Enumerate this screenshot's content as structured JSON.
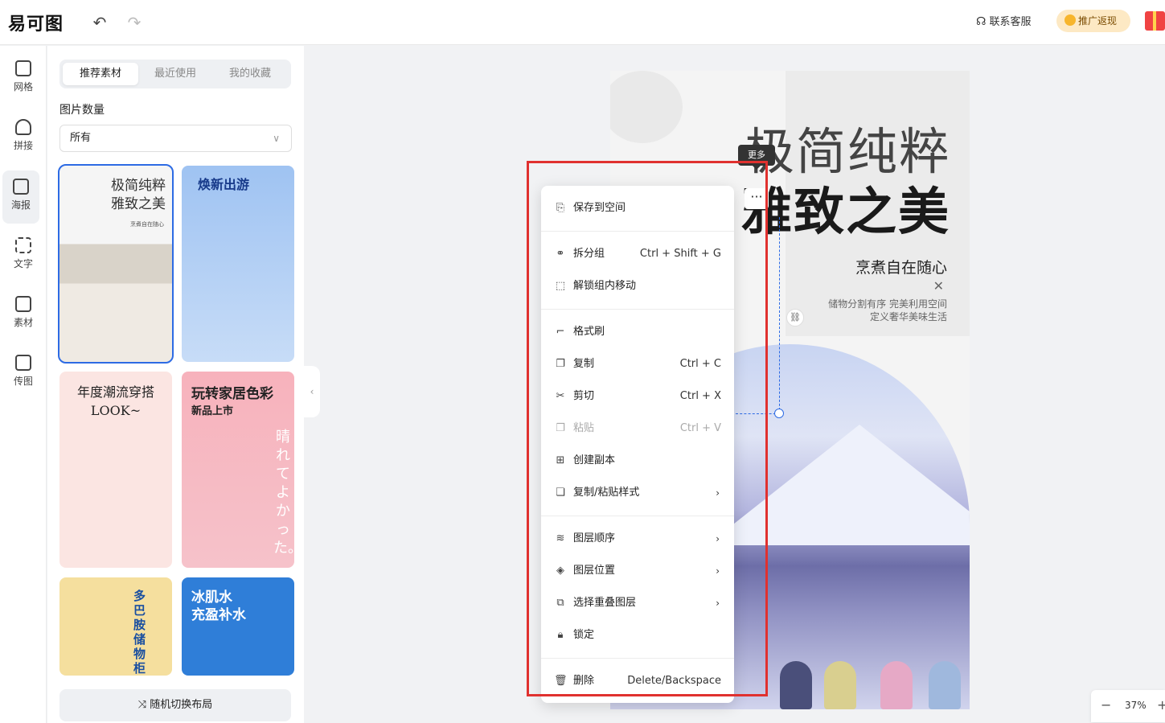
{
  "header": {
    "logo": "易可图",
    "undo_icon": "↶",
    "redo_icon": "↷",
    "support_label": "联系客服",
    "promo_label": "推广返现"
  },
  "rail": {
    "items": [
      {
        "label": "网格",
        "icon": "grid-icon"
      },
      {
        "label": "拼接",
        "icon": "splice-icon"
      },
      {
        "label": "海报",
        "icon": "poster-icon"
      },
      {
        "label": "文字",
        "icon": "text-icon"
      },
      {
        "label": "素材",
        "icon": "material-icon"
      },
      {
        "label": "传图",
        "icon": "upload-image-icon"
      }
    ],
    "active_index": 2
  },
  "panel": {
    "tabs": [
      "推荐素材",
      "最近使用",
      "我的收藏"
    ],
    "section_label": "图片数量",
    "select_value": "所有",
    "templates": [
      {
        "title_line1": "极简纯粹",
        "title_line2": "雅致之美",
        "sub": "烹煮自在随心"
      },
      {
        "title": "焕新出游"
      },
      {
        "title_line1": "年度潮流穿搭",
        "title_line2": "LOOK~"
      },
      {
        "title_line1": "玩转家居色彩",
        "title_line2": "新品上市"
      },
      {
        "title": "多巴胺储物柜"
      },
      {
        "title_line1": "冰肌水",
        "title_line2": "充盈补水"
      }
    ],
    "shuffle_label": "随机切换布局"
  },
  "poster": {
    "title": "极简纯粹",
    "subtitle": "雅致之美",
    "heading": "烹煮自在随心",
    "close_mark": "✕",
    "desc_line1": "储物分割有序 完美利用空间",
    "desc_line2": "定义奢华美味生活",
    "vertical_text": "晴れてよかった。"
  },
  "tooltip": {
    "label": "更多",
    "more_glyph": "···"
  },
  "context_menu": {
    "items": [
      {
        "label": "保存到空间",
        "icon": "save-to-space-icon",
        "shortcut": "",
        "submenu": false,
        "disabled": false
      },
      {
        "label": "拆分组",
        "icon": "ungroup-icon",
        "shortcut": "Ctrl + Shift + G",
        "submenu": false,
        "disabled": false
      },
      {
        "label": "解锁组内移动",
        "icon": "unlock-move-icon",
        "shortcut": "",
        "submenu": false,
        "disabled": false
      },
      {
        "label": "格式刷",
        "icon": "format-brush-icon",
        "shortcut": "",
        "submenu": false,
        "disabled": false
      },
      {
        "label": "复制",
        "icon": "copy-icon",
        "shortcut": "Ctrl + C",
        "submenu": false,
        "disabled": false
      },
      {
        "label": "剪切",
        "icon": "cut-icon",
        "shortcut": "Ctrl + X",
        "submenu": false,
        "disabled": false
      },
      {
        "label": "粘贴",
        "icon": "paste-icon",
        "shortcut": "Ctrl + V",
        "submenu": false,
        "disabled": true
      },
      {
        "label": "创建副本",
        "icon": "duplicate-icon",
        "shortcut": "",
        "submenu": false,
        "disabled": false
      },
      {
        "label": "复制/粘贴样式",
        "icon": "copy-style-icon",
        "shortcut": "",
        "submenu": true,
        "disabled": false
      },
      {
        "label": "图层顺序",
        "icon": "layer-order-icon",
        "shortcut": "",
        "submenu": true,
        "disabled": false
      },
      {
        "label": "图层位置",
        "icon": "layer-position-icon",
        "shortcut": "",
        "submenu": true,
        "disabled": false
      },
      {
        "label": "选择重叠图层",
        "icon": "overlap-layer-icon",
        "shortcut": "",
        "submenu": true,
        "disabled": false
      },
      {
        "label": "锁定",
        "icon": "lock-icon",
        "shortcut": "",
        "submenu": false,
        "disabled": false
      },
      {
        "label": "删除",
        "icon": "delete-icon",
        "shortcut": "Delete/Backspace",
        "submenu": false,
        "disabled": false
      }
    ],
    "arrow": "›"
  },
  "zoom": {
    "value": "37%",
    "minus": "−",
    "plus": "+"
  },
  "colors": {
    "accent": "#2d6be4",
    "annotation": "#e0312f"
  }
}
